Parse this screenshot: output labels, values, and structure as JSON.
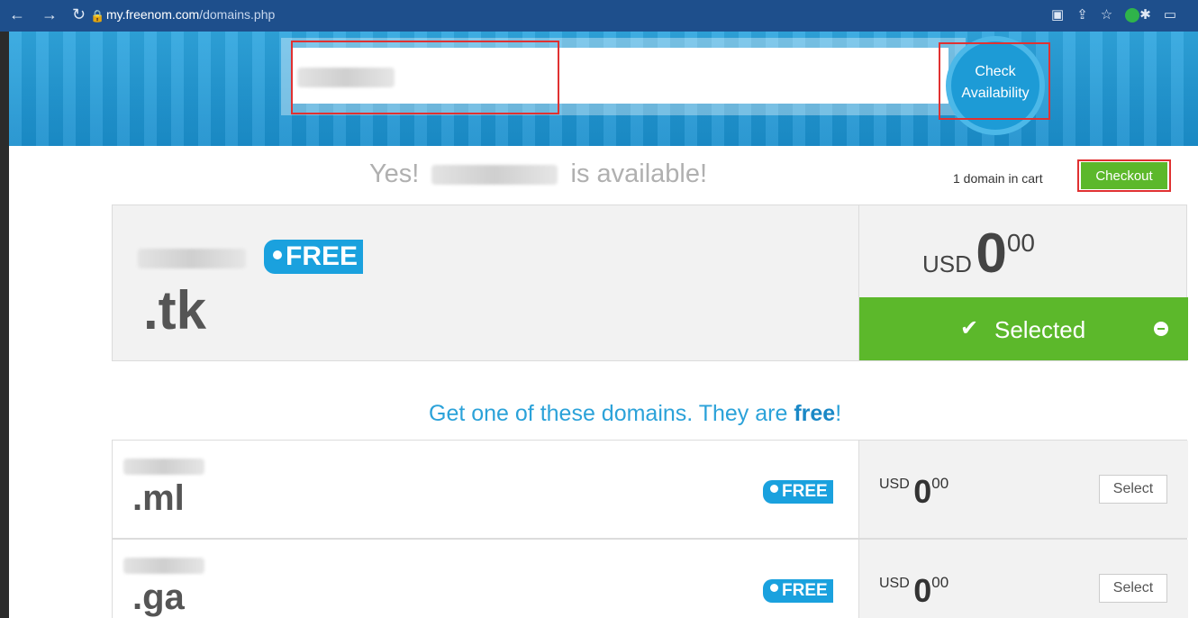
{
  "browser": {
    "back_icon": "arrow-left-icon",
    "url_domain": "my.freenom.com",
    "url_path": "/domains.php"
  },
  "search": {
    "value": "",
    "button_line1": "Check",
    "button_line2": "Availability"
  },
  "availability": {
    "prefix": "Yes!",
    "suffix": "is available!"
  },
  "cart": {
    "count_text": "1 domain in cart",
    "checkout_label": "Checkout"
  },
  "main_domain": {
    "tld": ".tk",
    "free_label": "FREE",
    "currency": "USD",
    "price_int": "0",
    "price_dec": "00",
    "selected_label": "Selected"
  },
  "promo": {
    "text": "Get one of these domains. They are ",
    "highlight": "free",
    "end": "!"
  },
  "alternatives": [
    {
      "tld": ".ml",
      "free_label": "FREE",
      "currency": "USD",
      "price_int": "0",
      "price_dec": "00",
      "select_label": "Select"
    },
    {
      "tld": ".ga",
      "free_label": "FREE",
      "currency": "USD",
      "price_int": "0",
      "price_dec": "00",
      "select_label": "Select"
    }
  ],
  "colors": {
    "accent_blue": "#1aa1de",
    "green": "#5cb82b",
    "highlight_red": "#e03131"
  }
}
